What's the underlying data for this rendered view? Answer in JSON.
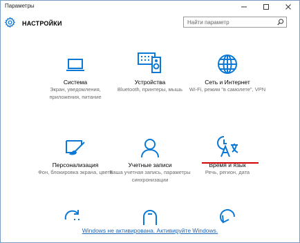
{
  "window": {
    "title": "Параметры"
  },
  "header": {
    "title": "НАСТРОЙКИ",
    "search_placeholder": "Найти параметр"
  },
  "tiles": [
    {
      "name": "Система",
      "desc": "Экран, уведомления, приложения, питание",
      "icon": "laptop-icon"
    },
    {
      "name": "Устройства",
      "desc": "Bluetooth, принтеры, мышь",
      "icon": "devices-icon"
    },
    {
      "name": "Сеть и Интернет",
      "desc": "Wi-Fi, режим \"в самолете\", VPN",
      "icon": "globe-icon"
    },
    {
      "name": "Персонализация",
      "desc": "Фон, блокировка экрана, цвета",
      "icon": "personalization-icon"
    },
    {
      "name": "Учетные записи",
      "desc": "Ваша учетная запись, параметры синхронизации",
      "icon": "account-icon"
    },
    {
      "name": "Время и язык",
      "desc": "Речь, регион, дата",
      "icon": "time-language-icon"
    }
  ],
  "colors": {
    "accent": "#0a78d4",
    "highlight_underline": "#d40000",
    "link": "#1a66b7"
  },
  "activation": {
    "text": "Windows не активирована. Активируйте Windows."
  }
}
